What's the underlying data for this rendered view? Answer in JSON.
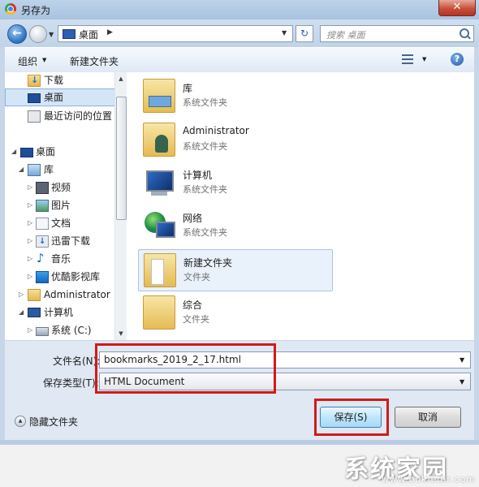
{
  "window": {
    "title": "另存为",
    "close_label": "✕"
  },
  "address": {
    "back_label": "←",
    "location": "桌面",
    "separator": "▶",
    "dropdown": "▼",
    "refresh": "↻",
    "search_placeholder": "搜索 桌面"
  },
  "toolbar": {
    "organize_label": "组织",
    "organize_arrow": "▼",
    "new_folder_label": "新建文件夹",
    "view_arrow": "▼",
    "help_label": "?"
  },
  "nav": {
    "items": [
      {
        "label": "下载",
        "icon": "download-folder-icon"
      },
      {
        "label": "桌面",
        "icon": "desktop-icon",
        "selected": true
      },
      {
        "label": "最近访问的位置",
        "icon": "recent-places-icon"
      },
      {
        "label": "桌面",
        "icon": "desktop-icon",
        "expanded": true
      },
      {
        "label": "库",
        "icon": "library-icon",
        "expanded": true
      },
      {
        "label": "视频",
        "icon": "video-library-icon"
      },
      {
        "label": "图片",
        "icon": "pictures-library-icon"
      },
      {
        "label": "文档",
        "icon": "documents-library-icon"
      },
      {
        "label": "迅雷下载",
        "icon": "xunlei-download-icon"
      },
      {
        "label": "音乐",
        "icon": "music-library-icon"
      },
      {
        "label": "优酷影视库",
        "icon": "youku-library-icon"
      },
      {
        "label": "Administrator",
        "icon": "user-folder-icon"
      },
      {
        "label": "计算机",
        "icon": "computer-icon",
        "expanded": true
      },
      {
        "label": "系统 (C:)",
        "icon": "drive-icon"
      }
    ]
  },
  "files": [
    {
      "name": "库",
      "type": "系统文件夹",
      "icon": "library-icon"
    },
    {
      "name": "Administrator",
      "type": "系统文件夹",
      "icon": "user-folder-icon"
    },
    {
      "name": "计算机",
      "type": "系统文件夹",
      "icon": "computer-icon"
    },
    {
      "name": "网络",
      "type": "系统文件夹",
      "icon": "network-icon"
    },
    {
      "name": "新建文件夹",
      "type": "文件夹",
      "icon": "folder-icon",
      "selected": true
    },
    {
      "name": "综合",
      "type": "文件夹",
      "icon": "folder-icon"
    }
  ],
  "form": {
    "filename_label": "文件名(N):",
    "filename_value": "bookmarks_2019_2_17.html",
    "filetype_label": "保存类型(T):",
    "filetype_value": "HTML Document",
    "arrow": "▼"
  },
  "footer": {
    "hide_folders_label": "隐藏文件夹",
    "hide_toggle": "▲",
    "save_label": "保存(S)",
    "cancel_label": "取消"
  },
  "watermark": {
    "text": "系统家园",
    "sub": "www.bokledir.com"
  },
  "colors": {
    "highlight_red": "#d21a1a",
    "selection_blue": "#d5e5f8",
    "frame_blue": "#c7d6e8"
  }
}
